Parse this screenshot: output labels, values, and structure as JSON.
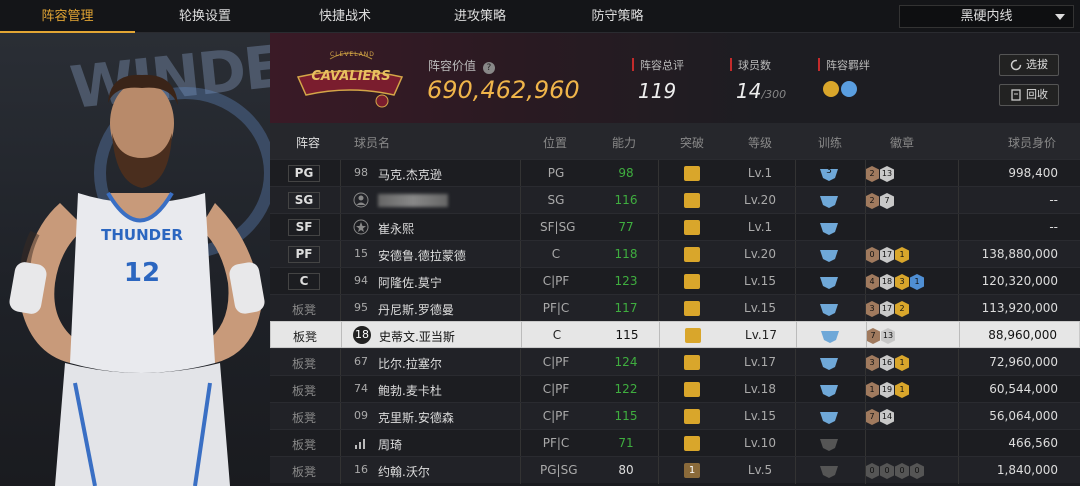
{
  "tabs": [
    "阵容管理",
    "轮换设置",
    "快捷战术",
    "进攻策略",
    "防守策略"
  ],
  "dropdown_value": "黑硬内线",
  "team": {
    "logo_top": "CLEVELAND",
    "logo_main": "CAVALIERS",
    "value_label": "阵容价值",
    "value": "690,462,960"
  },
  "stats": {
    "rating_label": "阵容总评",
    "rating": "119",
    "count_label": "球员数",
    "count": "14",
    "count_max": "/300",
    "bond_label": "阵容羁绊"
  },
  "buttons": {
    "select": "选拔",
    "recycle": "回收"
  },
  "headers": [
    "阵容",
    "球员名",
    "位置",
    "能力",
    "突破",
    "等级",
    "训练",
    "徽章",
    "球员身价"
  ],
  "player_art": {
    "jersey_team": "THUNDER",
    "jersey_number": "12",
    "bg_text": "WINDE"
  },
  "rows": [
    {
      "slot": "PG",
      "num": "98",
      "name": "马克.杰克逊",
      "pos": "PG",
      "ability": "98",
      "level": "Lv.1",
      "train": "3",
      "badges": [
        "2",
        "13"
      ],
      "value": "998,400"
    },
    {
      "slot": "SG",
      "num": "",
      "name": "",
      "pos": "SG",
      "ability": "116",
      "level": "Lv.20",
      "train": "",
      "badges": [
        "2",
        "7"
      ],
      "value": "--"
    },
    {
      "slot": "SF",
      "num": "",
      "name": "崔永熙",
      "pos": "SF|SG",
      "ability": "77",
      "level": "Lv.1",
      "train": "",
      "badges": [],
      "value": "--"
    },
    {
      "slot": "PF",
      "num": "15",
      "name": "安德鲁.德拉蒙德",
      "pos": "C",
      "ability": "118",
      "level": "Lv.20",
      "train": "",
      "badges": [
        "0",
        "17",
        "1"
      ],
      "value": "138,880,000"
    },
    {
      "slot": "C",
      "num": "94",
      "name": "阿隆佐.莫宁",
      "pos": "C|PF",
      "ability": "123",
      "level": "Lv.15",
      "train": "",
      "badges": [
        "4",
        "18",
        "3",
        "1"
      ],
      "value": "120,320,000"
    },
    {
      "slot": "板凳",
      "num": "95",
      "name": "丹尼斯.罗德曼",
      "pos": "PF|C",
      "ability": "117",
      "level": "Lv.15",
      "train": "",
      "badges": [
        "3",
        "17",
        "2"
      ],
      "value": "113,920,000"
    },
    {
      "slot": "板凳",
      "num": "18",
      "name": "史蒂文.亚当斯",
      "pos": "C",
      "ability": "115",
      "level": "Lv.17",
      "train": "",
      "badges": [
        "7",
        "13"
      ],
      "value": "88,960,000"
    },
    {
      "slot": "板凳",
      "num": "67",
      "name": "比尔.拉塞尔",
      "pos": "C|PF",
      "ability": "124",
      "level": "Lv.17",
      "train": "",
      "badges": [
        "3",
        "16",
        "1"
      ],
      "value": "72,960,000"
    },
    {
      "slot": "板凳",
      "num": "74",
      "name": "鲍勃.麦卡杜",
      "pos": "C|PF",
      "ability": "122",
      "level": "Lv.18",
      "train": "",
      "badges": [
        "1",
        "19",
        "1"
      ],
      "value": "60,544,000"
    },
    {
      "slot": "板凳",
      "num": "09",
      "name": "克里斯.安德森",
      "pos": "C|PF",
      "ability": "115",
      "level": "Lv.15",
      "train": "",
      "badges": [
        "7",
        "14"
      ],
      "value": "56,064,000"
    },
    {
      "slot": "板凳",
      "num": "",
      "name": "周琦",
      "pos": "PF|C",
      "ability": "71",
      "level": "Lv.10",
      "train": "",
      "badges": [],
      "value": "466,560"
    },
    {
      "slot": "板凳",
      "num": "16",
      "name": "约翰.沃尔",
      "pos": "PG|SG",
      "ability": "80",
      "level": "Lv.5",
      "train": "",
      "badges": [
        "0",
        "0",
        "0",
        "0"
      ],
      "value": "1,840,000",
      "breakthrough": "1"
    }
  ],
  "colors": {
    "accent": "#e2a534",
    "ability_green": "#3fae3f",
    "crown_gold": "#d9a62b",
    "team_red": "#c32b2b",
    "gold_value": "#f0b54a"
  }
}
